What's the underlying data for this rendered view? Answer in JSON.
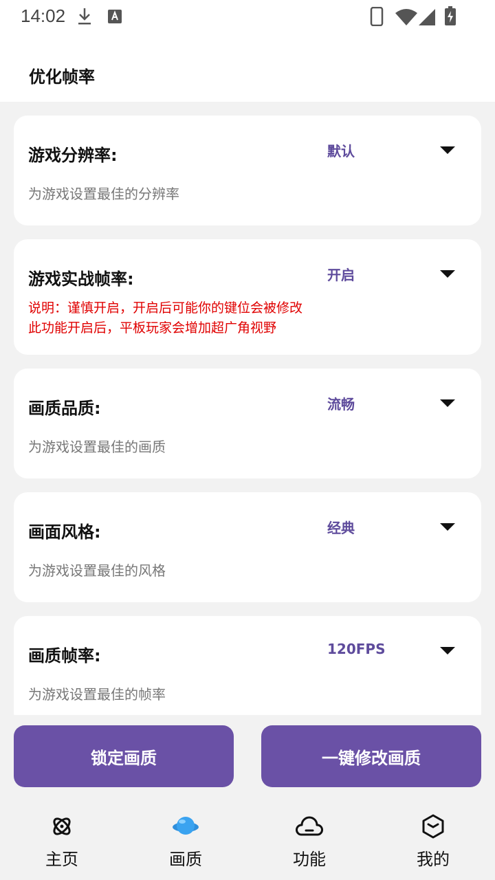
{
  "status_bar": {
    "time": "14:02"
  },
  "header": {
    "title": "优化帧率"
  },
  "cards": [
    {
      "title": "游戏分辨率:",
      "value": "默认",
      "desc": "为游戏设置最佳的分辨率"
    },
    {
      "title": "游戏实战帧率:",
      "value": "开启",
      "warn_line1": "说明：谨慎开启，开启后可能你的键位会被修改",
      "warn_line2": "此功能开启后，平板玩家会增加超广角视野"
    },
    {
      "title": "画质品质:",
      "value": "流畅",
      "desc": "为游戏设置最佳的画质"
    },
    {
      "title": "画面风格:",
      "value": "经典",
      "desc": "为游戏设置最佳的风格"
    },
    {
      "title": "画质帧率:",
      "value": "120FPS",
      "desc": "为游戏设置最佳的帧率"
    }
  ],
  "actions": {
    "lock_label": "锁定画质",
    "modify_label": "一键修改画质"
  },
  "nav": [
    {
      "label": "主页",
      "icon": "orbit-icon"
    },
    {
      "label": "画质",
      "icon": "blue-planet-icon"
    },
    {
      "label": "功能",
      "icon": "cloud-icon"
    },
    {
      "label": "我的",
      "icon": "cube-icon"
    }
  ],
  "colors": {
    "accent": "#6a51a6",
    "value_text": "#5e4b9c",
    "warning": "#e00000",
    "active_nav": "#3aa3f0"
  }
}
